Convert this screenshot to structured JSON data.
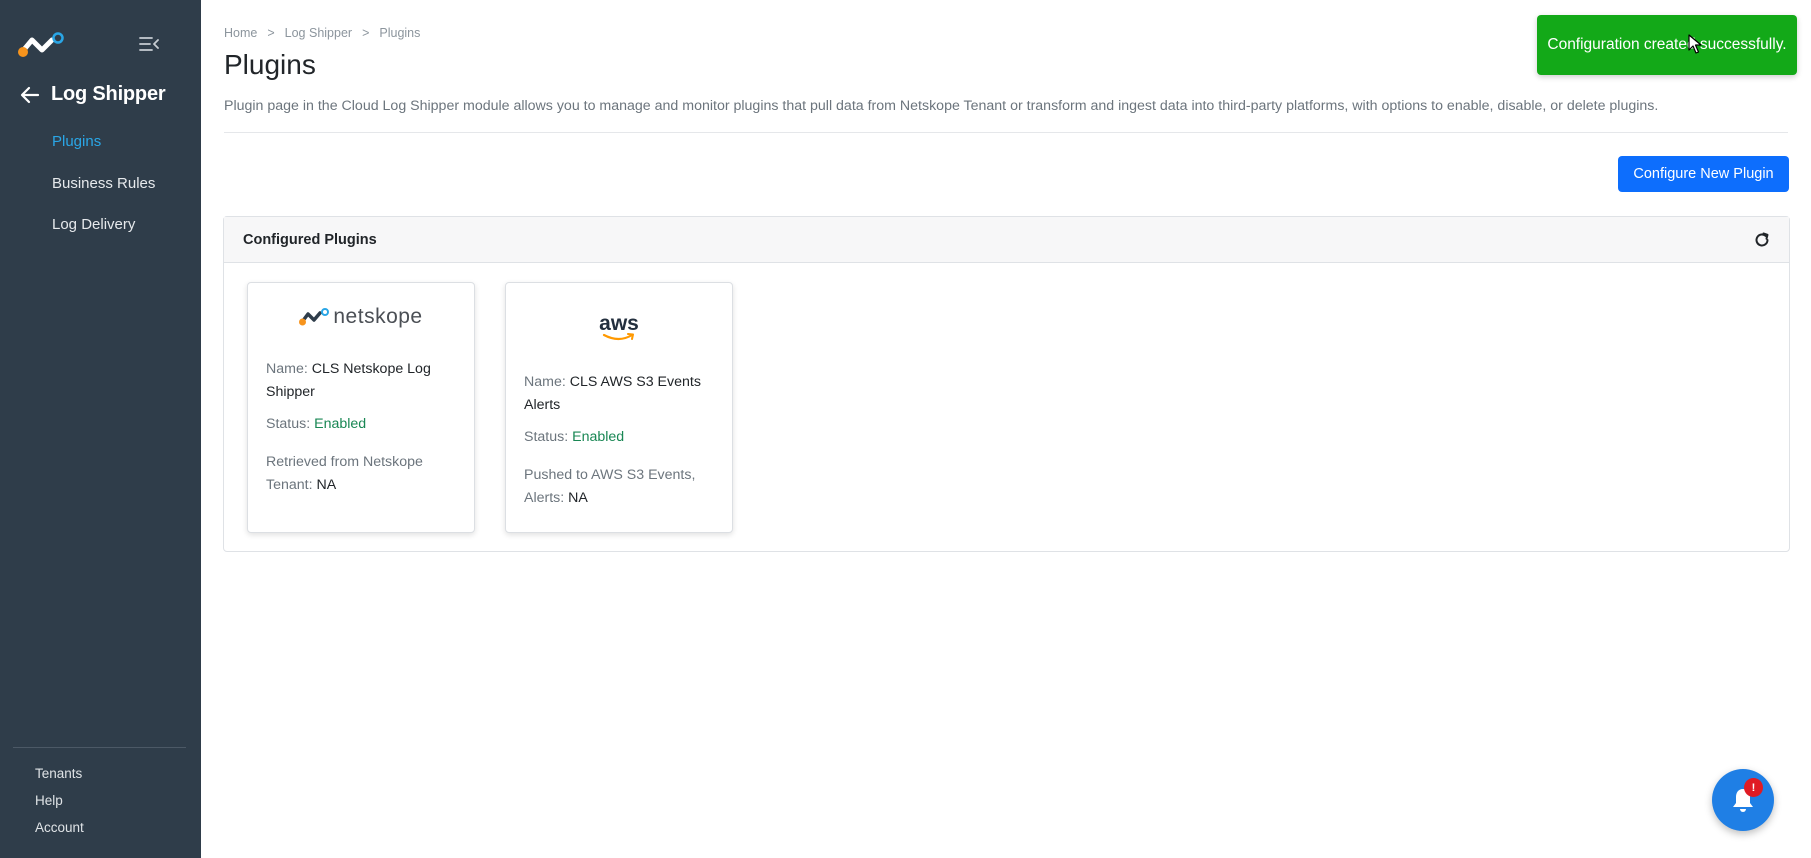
{
  "sidebar": {
    "module_title": "Log Shipper",
    "items": [
      {
        "label": "Plugins",
        "active": true
      },
      {
        "label": "Business Rules",
        "active": false
      },
      {
        "label": "Log Delivery",
        "active": false
      }
    ],
    "footer_items": [
      {
        "label": "Tenants"
      },
      {
        "label": "Help"
      },
      {
        "label": "Account"
      }
    ]
  },
  "breadcrumb": [
    "Home",
    "Log Shipper",
    "Plugins"
  ],
  "breadcrumb_separator": ">",
  "page": {
    "title": "Plugins",
    "description": "Plugin page in the Cloud Log Shipper module allows you to manage and monitor plugins that pull data from Netskope Tenant or transform and ingest data into third-party platforms, with options to enable, disable, or delete plugins."
  },
  "configure_button": "Configure New Plugin",
  "panel": {
    "title": "Configured Plugins"
  },
  "cards": [
    {
      "logo_text": "netskope",
      "name_label": "Name:",
      "name": "CLS Netskope Log Shipper",
      "status_label": "Status:",
      "status": "Enabled",
      "detail_label": "Retrieved from Netskope Tenant:",
      "detail_value": "NA"
    },
    {
      "logo_text": "aws",
      "name_label": "Name:",
      "name": "CLS AWS S3 Events Alerts",
      "status_label": "Status:",
      "status": "Enabled",
      "detail_label": "Pushed to AWS S3 Events, Alerts:",
      "detail_value": "NA"
    }
  ],
  "toast": {
    "message": "Configuration created successfully."
  },
  "notification_badge": "!",
  "colors": {
    "sidebar_bg": "#2f3d4a",
    "active_nav": "#2aa6e6",
    "primary": "#0d6efd",
    "success_toast": "#13a918",
    "status_enabled": "#198754"
  }
}
